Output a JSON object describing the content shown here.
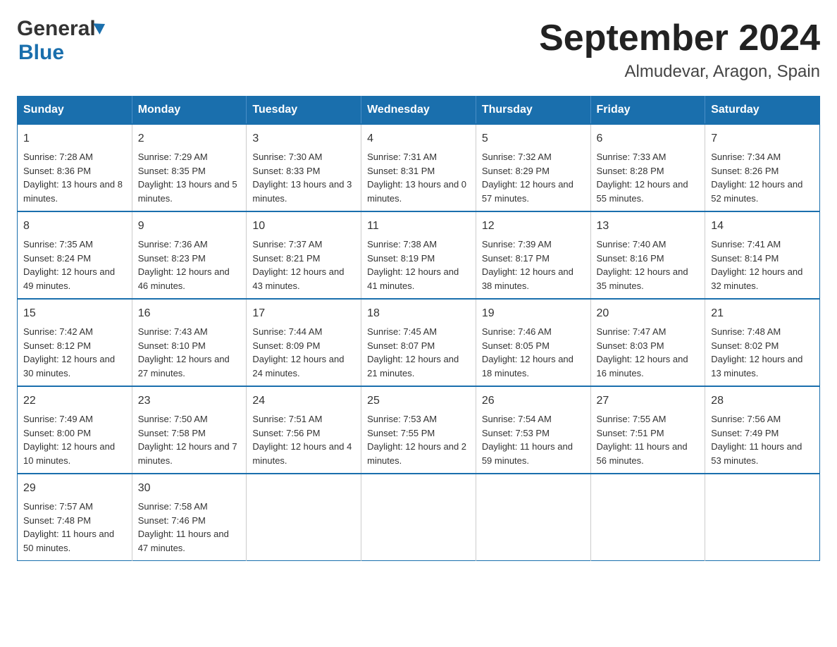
{
  "logo": {
    "general": "General",
    "blue": "Blue"
  },
  "title": {
    "month_year": "September 2024",
    "location": "Almudevar, Aragon, Spain"
  },
  "days_of_week": [
    "Sunday",
    "Monday",
    "Tuesday",
    "Wednesday",
    "Thursday",
    "Friday",
    "Saturday"
  ],
  "weeks": [
    [
      {
        "day": "1",
        "sunrise": "7:28 AM",
        "sunset": "8:36 PM",
        "daylight": "13 hours and 8 minutes."
      },
      {
        "day": "2",
        "sunrise": "7:29 AM",
        "sunset": "8:35 PM",
        "daylight": "13 hours and 5 minutes."
      },
      {
        "day": "3",
        "sunrise": "7:30 AM",
        "sunset": "8:33 PM",
        "daylight": "13 hours and 3 minutes."
      },
      {
        "day": "4",
        "sunrise": "7:31 AM",
        "sunset": "8:31 PM",
        "daylight": "13 hours and 0 minutes."
      },
      {
        "day": "5",
        "sunrise": "7:32 AM",
        "sunset": "8:29 PM",
        "daylight": "12 hours and 57 minutes."
      },
      {
        "day": "6",
        "sunrise": "7:33 AM",
        "sunset": "8:28 PM",
        "daylight": "12 hours and 55 minutes."
      },
      {
        "day": "7",
        "sunrise": "7:34 AM",
        "sunset": "8:26 PM",
        "daylight": "12 hours and 52 minutes."
      }
    ],
    [
      {
        "day": "8",
        "sunrise": "7:35 AM",
        "sunset": "8:24 PM",
        "daylight": "12 hours and 49 minutes."
      },
      {
        "day": "9",
        "sunrise": "7:36 AM",
        "sunset": "8:23 PM",
        "daylight": "12 hours and 46 minutes."
      },
      {
        "day": "10",
        "sunrise": "7:37 AM",
        "sunset": "8:21 PM",
        "daylight": "12 hours and 43 minutes."
      },
      {
        "day": "11",
        "sunrise": "7:38 AM",
        "sunset": "8:19 PM",
        "daylight": "12 hours and 41 minutes."
      },
      {
        "day": "12",
        "sunrise": "7:39 AM",
        "sunset": "8:17 PM",
        "daylight": "12 hours and 38 minutes."
      },
      {
        "day": "13",
        "sunrise": "7:40 AM",
        "sunset": "8:16 PM",
        "daylight": "12 hours and 35 minutes."
      },
      {
        "day": "14",
        "sunrise": "7:41 AM",
        "sunset": "8:14 PM",
        "daylight": "12 hours and 32 minutes."
      }
    ],
    [
      {
        "day": "15",
        "sunrise": "7:42 AM",
        "sunset": "8:12 PM",
        "daylight": "12 hours and 30 minutes."
      },
      {
        "day": "16",
        "sunrise": "7:43 AM",
        "sunset": "8:10 PM",
        "daylight": "12 hours and 27 minutes."
      },
      {
        "day": "17",
        "sunrise": "7:44 AM",
        "sunset": "8:09 PM",
        "daylight": "12 hours and 24 minutes."
      },
      {
        "day": "18",
        "sunrise": "7:45 AM",
        "sunset": "8:07 PM",
        "daylight": "12 hours and 21 minutes."
      },
      {
        "day": "19",
        "sunrise": "7:46 AM",
        "sunset": "8:05 PM",
        "daylight": "12 hours and 18 minutes."
      },
      {
        "day": "20",
        "sunrise": "7:47 AM",
        "sunset": "8:03 PM",
        "daylight": "12 hours and 16 minutes."
      },
      {
        "day": "21",
        "sunrise": "7:48 AM",
        "sunset": "8:02 PM",
        "daylight": "12 hours and 13 minutes."
      }
    ],
    [
      {
        "day": "22",
        "sunrise": "7:49 AM",
        "sunset": "8:00 PM",
        "daylight": "12 hours and 10 minutes."
      },
      {
        "day": "23",
        "sunrise": "7:50 AM",
        "sunset": "7:58 PM",
        "daylight": "12 hours and 7 minutes."
      },
      {
        "day": "24",
        "sunrise": "7:51 AM",
        "sunset": "7:56 PM",
        "daylight": "12 hours and 4 minutes."
      },
      {
        "day": "25",
        "sunrise": "7:53 AM",
        "sunset": "7:55 PM",
        "daylight": "12 hours and 2 minutes."
      },
      {
        "day": "26",
        "sunrise": "7:54 AM",
        "sunset": "7:53 PM",
        "daylight": "11 hours and 59 minutes."
      },
      {
        "day": "27",
        "sunrise": "7:55 AM",
        "sunset": "7:51 PM",
        "daylight": "11 hours and 56 minutes."
      },
      {
        "day": "28",
        "sunrise": "7:56 AM",
        "sunset": "7:49 PM",
        "daylight": "11 hours and 53 minutes."
      }
    ],
    [
      {
        "day": "29",
        "sunrise": "7:57 AM",
        "sunset": "7:48 PM",
        "daylight": "11 hours and 50 minutes."
      },
      {
        "day": "30",
        "sunrise": "7:58 AM",
        "sunset": "7:46 PM",
        "daylight": "11 hours and 47 minutes."
      },
      null,
      null,
      null,
      null,
      null
    ]
  ],
  "labels": {
    "sunrise": "Sunrise:",
    "sunset": "Sunset:",
    "daylight": "Daylight:"
  }
}
